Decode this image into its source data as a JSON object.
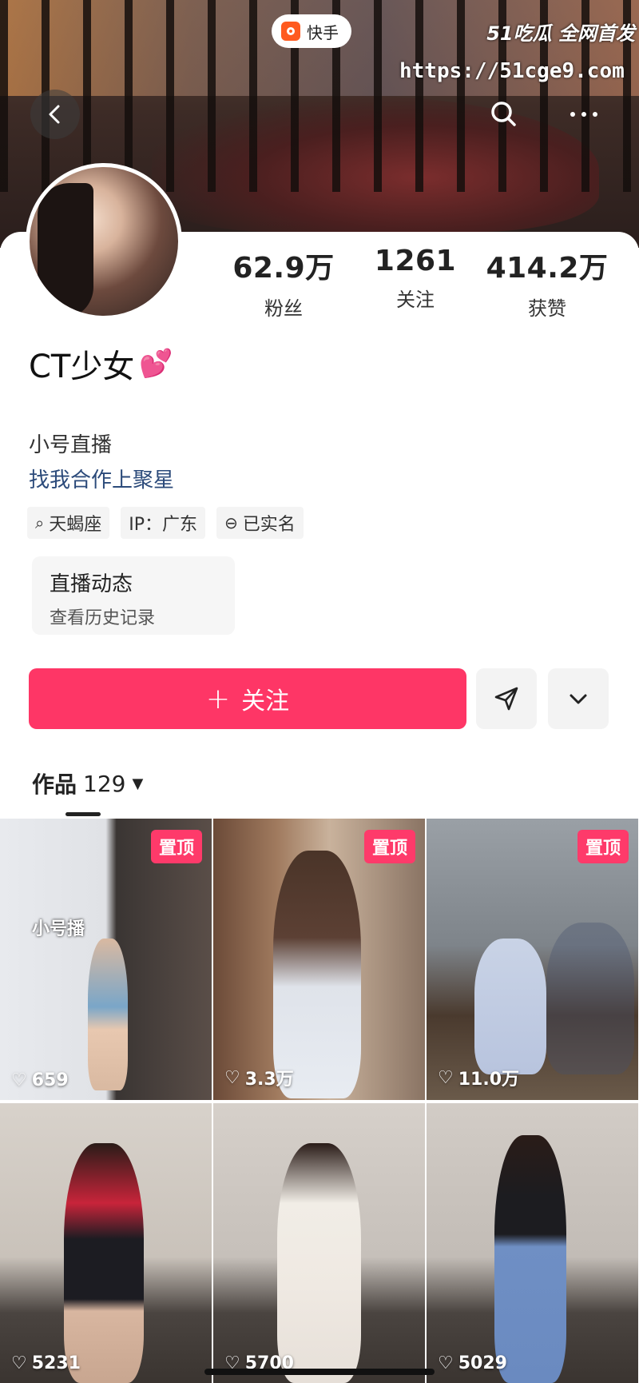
{
  "app": {
    "name": "快手",
    "watermark": "51吃瓜 全网首发",
    "watermark_url": "https://51cge9.com"
  },
  "profile": {
    "name": "CT少女",
    "stats": [
      {
        "value": "62.9万",
        "label": "粉丝"
      },
      {
        "value": "1261",
        "label": "关注"
      },
      {
        "value": "414.2万",
        "label": "获赞"
      }
    ],
    "bio_line1": "小号直播",
    "bio_line2": "找我合作上聚星",
    "tags": [
      {
        "icon": "search-icon",
        "label": "天蝎座"
      },
      {
        "icon": "",
        "label": "IP：广东"
      },
      {
        "icon": "verified-icon",
        "label": "已实名"
      }
    ],
    "live_card": {
      "title": "直播动态",
      "subtitle": "查看历史记录"
    }
  },
  "actions": {
    "follow_label": "关注",
    "follow_icon": "plus-icon",
    "share_icon": "send-icon",
    "more_icon": "chevron-down-icon"
  },
  "works": {
    "tab_label": "作品",
    "count": "129",
    "items": [
      {
        "pinned": true,
        "pin_label": "置顶",
        "likes": "659",
        "overlay": "小号播"
      },
      {
        "pinned": true,
        "pin_label": "置顶",
        "likes": "3.3万",
        "overlay": ""
      },
      {
        "pinned": true,
        "pin_label": "置顶",
        "likes": "11.0万",
        "overlay": ""
      },
      {
        "pinned": false,
        "pin_label": "",
        "likes": "5231",
        "overlay": ""
      },
      {
        "pinned": false,
        "pin_label": "",
        "likes": "5700",
        "overlay": ""
      },
      {
        "pinned": false,
        "pin_label": "",
        "likes": "5029",
        "overlay": ""
      }
    ]
  },
  "colors": {
    "accent": "#fe3666",
    "pin": "#fe3a6a",
    "link": "#2b4a7a"
  }
}
